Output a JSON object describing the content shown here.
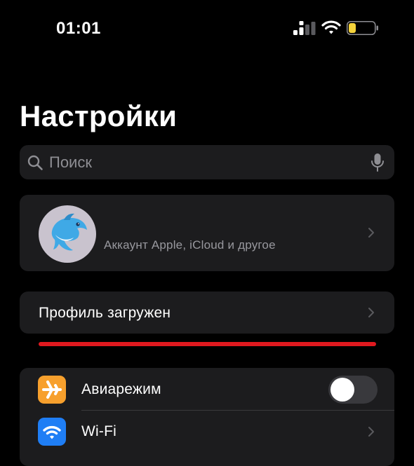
{
  "status_bar": {
    "time": "01:01",
    "signal_icon": "cellular-signal-icon",
    "wifi_icon": "wifi-icon",
    "battery_icon": "battery-low-icon",
    "battery_level": 0.2,
    "battery_color": "#f5d33b"
  },
  "header": {
    "title": "Настройки"
  },
  "search": {
    "placeholder": "Поиск",
    "value": ""
  },
  "profile": {
    "avatar_icon": "dolphin-avatar-icon",
    "subtitle": "Аккаунт Apple, iCloud и другое"
  },
  "profile_loaded": {
    "label": "Профиль загружен"
  },
  "settings": {
    "items": [
      {
        "label": "Авиарежим",
        "icon": "airplane-icon",
        "icon_color": "#f7a02d",
        "toggle": false
      },
      {
        "label": "Wi-Fi",
        "icon": "wifi-icon",
        "icon_color": "#1f7ef5"
      }
    ]
  },
  "colors": {
    "background": "#000000",
    "card": "#1c1c1e",
    "accent_red": "#e0191f",
    "secondary_text": "#98989e"
  }
}
